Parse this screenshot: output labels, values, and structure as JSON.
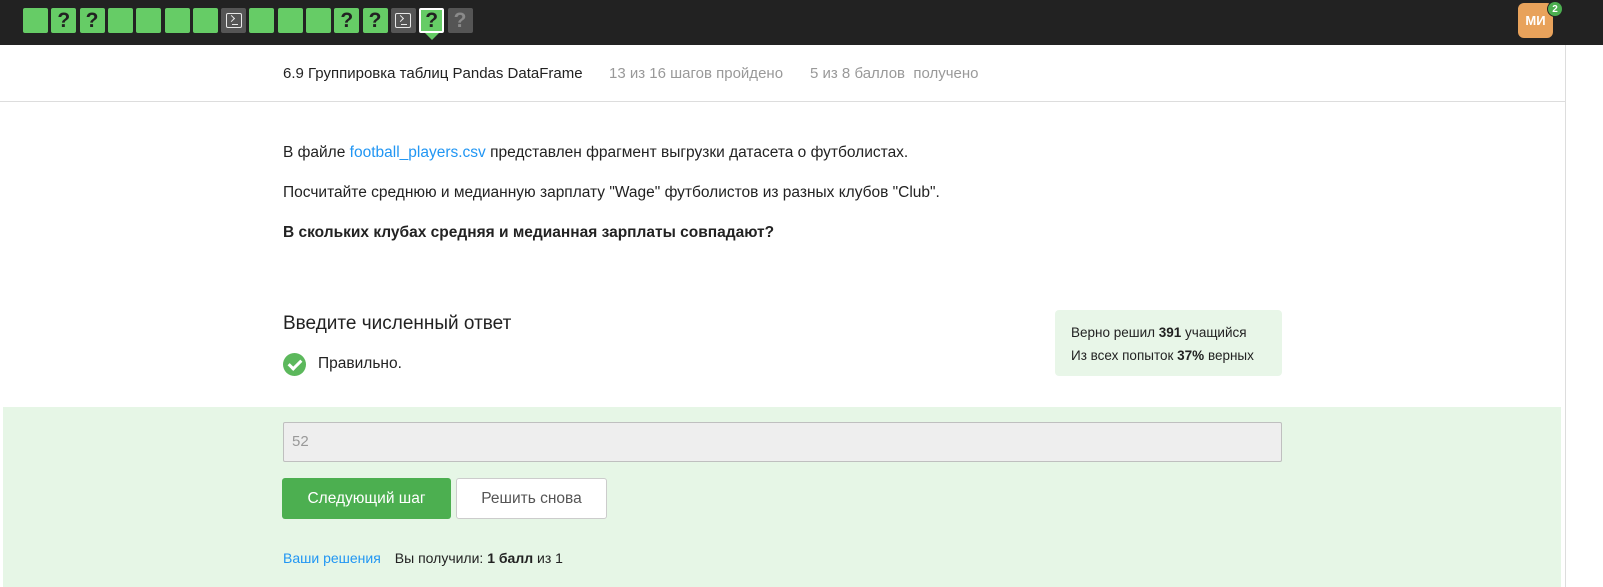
{
  "topbar": {
    "steps": [
      {
        "kind": "text",
        "status": "passed",
        "icon": ""
      },
      {
        "kind": "quiz",
        "status": "passed",
        "icon": "?"
      },
      {
        "kind": "quiz",
        "status": "passed",
        "icon": "?"
      },
      {
        "kind": "text",
        "status": "passed",
        "icon": ""
      },
      {
        "kind": "text",
        "status": "passed",
        "icon": ""
      },
      {
        "kind": "text",
        "status": "passed",
        "icon": ""
      },
      {
        "kind": "text",
        "status": "passed",
        "icon": ""
      },
      {
        "kind": "code",
        "status": "not-passed",
        "icon": "terminal-icon"
      },
      {
        "kind": "text",
        "status": "passed",
        "icon": ""
      },
      {
        "kind": "text",
        "status": "passed",
        "icon": ""
      },
      {
        "kind": "text",
        "status": "passed",
        "icon": ""
      },
      {
        "kind": "quiz",
        "status": "passed",
        "icon": "?"
      },
      {
        "kind": "quiz",
        "status": "passed",
        "icon": "?"
      },
      {
        "kind": "code",
        "status": "not-passed",
        "icon": "terminal-icon"
      },
      {
        "kind": "quiz",
        "status": "passed",
        "icon": "?",
        "active": true
      },
      {
        "kind": "quiz",
        "status": "not-passed",
        "icon": "?"
      }
    ],
    "avatar_initials": "МИ",
    "notifications": "2"
  },
  "header": {
    "lesson_title": "6.9 Группировка таблиц Pandas DataFrame",
    "steps_progress": "13 из 16 шагов пройдено",
    "score": "5 из 8 баллов  получено"
  },
  "task": {
    "p1_before": "В файле ",
    "p1_link": "football_players.csv",
    "p1_after": " представлен фрагмент выгрузки датасета о футболистах.",
    "p2": "Посчитайте среднюю и медианную зарплату \"Wage\" футболистов из разных клубов \"Club\".",
    "p3": "В скольких клубах средняя и медианная зарплаты совпадают?"
  },
  "answer": {
    "heading": "Введите численный ответ",
    "result_text": "Правильно.",
    "value": "52",
    "next_button": "Следующий шаг",
    "retry_button": "Решить снова"
  },
  "stats": {
    "line1_before": "Верно решил ",
    "line1_count": "391",
    "line1_after": " учащийся",
    "line2_before": "Из всех попыток ",
    "line2_percent": "37%",
    "line2_after": " верных"
  },
  "footer": {
    "solutions_link": "Ваши решения",
    "received_before": "Вы получили: ",
    "received_points": "1 балл",
    "received_after": " из 1"
  },
  "colors": {
    "topbar": "#222222",
    "step_passed": "#66cc66",
    "step_not_passed": "#555555",
    "accent_green": "#4caf50",
    "link": "#2196f3",
    "answer_bg": "#e6f6e6",
    "avatar": "#e8a25b"
  }
}
